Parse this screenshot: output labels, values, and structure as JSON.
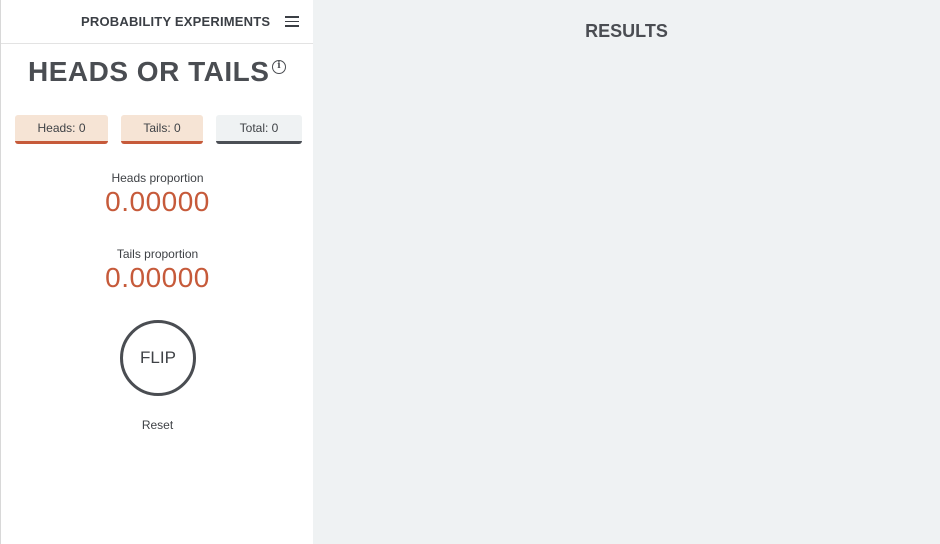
{
  "header": {
    "app_title": "PROBABILITY EXPERIMENTS",
    "menu_icon": "hamburger-menu-icon"
  },
  "experiment": {
    "title": "HEADS OR TAILS",
    "info_icon": "info-icon",
    "info_glyph": "i"
  },
  "counters": {
    "heads": "Heads: 0",
    "tails": "Tails: 0",
    "total": "Total: 0"
  },
  "proportions": {
    "heads_label": "Heads proportion",
    "heads_value": "0.00000",
    "tails_label": "Tails proportion",
    "tails_value": "0.00000"
  },
  "controls": {
    "flip_label": "FLIP",
    "reset_label": "Reset"
  },
  "results": {
    "title": "RESULTS"
  },
  "colors": {
    "accent": "#c65a3a",
    "counter_bg": "#f6e4d5",
    "results_bg": "#eff2f3",
    "dark": "#4a4d52"
  }
}
